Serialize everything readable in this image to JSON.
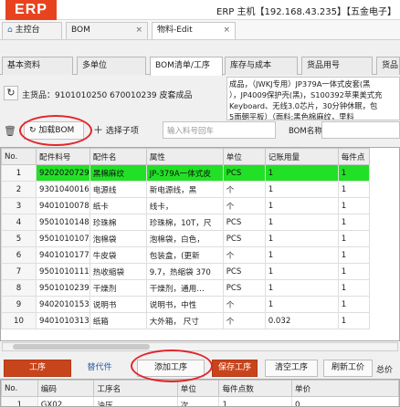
{
  "titlebar": {
    "logo": "ERP",
    "host": "ERP 主机【192.168.43.235】【五金电子】"
  },
  "top_tabs": [
    {
      "label": "主控台",
      "icon": "home-icon"
    },
    {
      "label": "BOM",
      "close": "×"
    },
    {
      "label": "物料-Edit",
      "close": "×"
    }
  ],
  "sub_tabs": [
    "基本资料",
    "多单位",
    "BOM清单/工序",
    "库存与成本",
    "货品用号",
    "货品"
  ],
  "product": {
    "info": "主货品：9101010250 670010239 皮套成品",
    "desc_lines": [
      "成品，（JWKJ专用）JP379A一体式皮套(黑",
      "），JP4009保护壳(黑)，S100392苹果美式充",
      "Keyboard、无线3.0芯片，30分钟休眠，包",
      "5面朝平板）（面料:黑色棉麻纹，里料"
    ]
  },
  "toolbar": {
    "load_bom": "加载BOM",
    "select_child": "选择子项",
    "search_placeholder": "输入料号回车",
    "bom_name_label": "BOM名称"
  },
  "grid": {
    "columns": [
      "No.",
      "配件料号",
      "配件名",
      "属性",
      "单位",
      "记账用量",
      "每件点"
    ],
    "rows": [
      {
        "no": "1",
        "code": "9202020729",
        "name": "黑棉麻纹",
        "attr": "JP-379A一体式皮",
        "unit": "PCS",
        "qty": "1",
        "per": "1",
        "highlight": true
      },
      {
        "no": "2",
        "code": "9301040016",
        "name": "电源线",
        "attr": "新电源线，黑",
        "unit": "个",
        "qty": "1",
        "per": "1"
      },
      {
        "no": "3",
        "code": "9401010078",
        "name": "纸卡",
        "attr": "线卡，",
        "unit": "个",
        "qty": "1",
        "per": "1"
      },
      {
        "no": "4",
        "code": "9501010148",
        "name": "珍珠棉",
        "attr": "珍珠棉，10T，尺",
        "unit": "PCS",
        "qty": "1",
        "per": "1"
      },
      {
        "no": "5",
        "code": "9501010107",
        "name": "泡棉袋",
        "attr": "泡棉袋，白色，",
        "unit": "PCS",
        "qty": "1",
        "per": "1"
      },
      {
        "no": "6",
        "code": "9401010177",
        "name": "牛皮袋",
        "attr": "包装盒，(更新",
        "unit": "个",
        "qty": "1",
        "per": "1"
      },
      {
        "no": "7",
        "code": "9501010111",
        "name": "热收缩袋",
        "attr": "9.7，热缩袋 370",
        "unit": "PCS",
        "qty": "1",
        "per": "1"
      },
      {
        "no": "8",
        "code": "9501010239",
        "name": "干燥剂",
        "attr": "干燥剂，通用…",
        "unit": "PCS",
        "qty": "1",
        "per": "1"
      },
      {
        "no": "9",
        "code": "9402010153",
        "name": "说明书",
        "attr": "说明书，中性",
        "unit": "个",
        "qty": "1",
        "per": "1"
      },
      {
        "no": "10",
        "code": "9401010313",
        "name": "纸箱",
        "attr": "大外箱，  尺寸",
        "unit": "个",
        "qty": "0.032",
        "per": "1"
      }
    ]
  },
  "bottom": {
    "process_tab": "工序",
    "alt_parts": "替代件",
    "add_process": "添加工序",
    "save_process": "保存工序",
    "clear_process": "清空工序",
    "refresh_price": "刷新工价",
    "total_price": "总价"
  },
  "subgrid": {
    "columns": [
      "No.",
      "编码",
      "工序名",
      "单位",
      "每件点数",
      "单价"
    ],
    "rows": [
      {
        "no": "1",
        "code": "GX02",
        "name": "油压",
        "unit": "次",
        "points": "1",
        "price": "0"
      }
    ]
  },
  "colors": {
    "accent": "#e8431f",
    "highlight_row": "#22e026",
    "annotation": "#e0262b"
  }
}
